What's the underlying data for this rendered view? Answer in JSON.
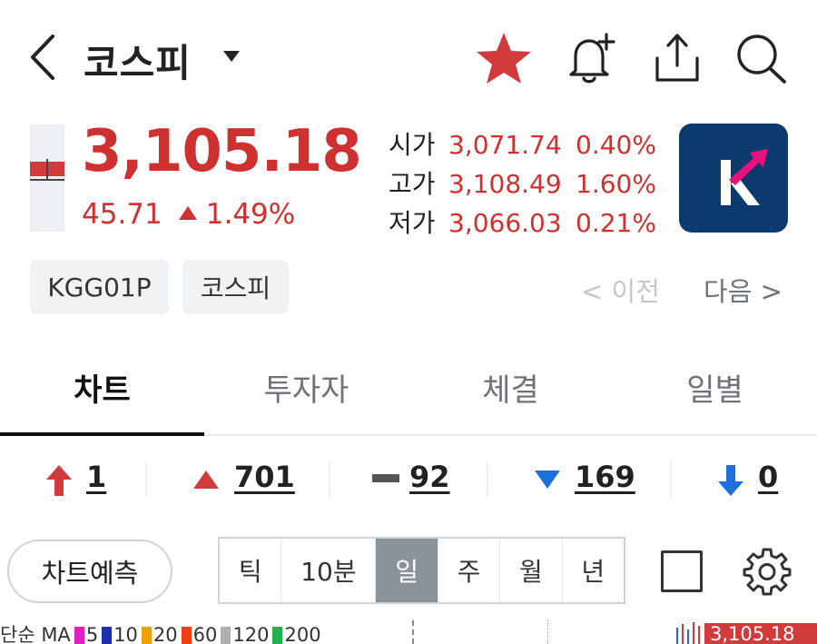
{
  "header": {
    "title": "코스피",
    "icons": [
      "back-icon",
      "caret-down-icon",
      "star-icon",
      "bell-plus-icon",
      "share-icon",
      "search-icon"
    ],
    "favorite_color": "#d23b3b"
  },
  "quote": {
    "price": "3,105.18",
    "change": "45.71",
    "change_pct": "1.49%",
    "direction": "up",
    "up_color": "#cf3131",
    "stats": [
      {
        "label": "시가",
        "value": "3,071.74",
        "pct": "0.40%"
      },
      {
        "label": "고가",
        "value": "3,108.49",
        "pct": "1.60%"
      },
      {
        "label": "저가",
        "value": "3,066.03",
        "pct": "0.21%"
      }
    ],
    "logo_letter": "K",
    "logo_colors": {
      "bg": "#0b3a6e",
      "arrow": "#e8127a"
    }
  },
  "tags": [
    "KGG01P",
    "코스피"
  ],
  "pager": {
    "prev": "< 이전",
    "next": "다음 >"
  },
  "tabs": [
    {
      "label": "차트",
      "active": true
    },
    {
      "label": "투자자",
      "active": false
    },
    {
      "label": "체결",
      "active": false
    },
    {
      "label": "일별",
      "active": false
    }
  ],
  "breadth": [
    {
      "icon": "upper-limit-arrow-icon",
      "count": "1"
    },
    {
      "icon": "up-triangle-icon",
      "count": "701"
    },
    {
      "icon": "unchanged-dash-icon",
      "count": "92"
    },
    {
      "icon": "down-triangle-icon",
      "count": "169"
    },
    {
      "icon": "lower-limit-arrow-icon",
      "count": "0"
    }
  ],
  "controls": {
    "predict_label": "차트예측",
    "periods": [
      {
        "label": "틱",
        "active": false
      },
      {
        "label": "10분",
        "active": false
      },
      {
        "label": "일",
        "active": true
      },
      {
        "label": "주",
        "active": false
      },
      {
        "label": "월",
        "active": false
      },
      {
        "label": "년",
        "active": false
      }
    ]
  },
  "ma_legend": {
    "label": "단순 MA",
    "items": [
      {
        "period": "5",
        "color": "#e020c0"
      },
      {
        "period": "10",
        "color": "#1f2fb0"
      },
      {
        "period": "20",
        "color": "#f0a000"
      },
      {
        "period": "60",
        "color": "#f04010"
      },
      {
        "period": "120",
        "color": "#b0b0b0"
      },
      {
        "period": "200",
        "color": "#20b050"
      }
    ],
    "price_tag": "3,105.18"
  }
}
